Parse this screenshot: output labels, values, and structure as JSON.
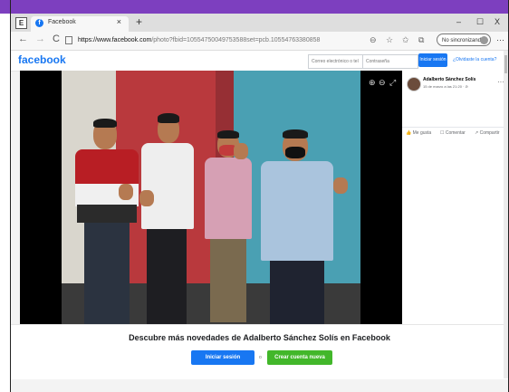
{
  "browser": {
    "logo": "E",
    "tab": {
      "title": "Facebook",
      "close": "×"
    },
    "new_tab": "+",
    "window_controls": [
      "–",
      "☐",
      "X"
    ],
    "nav": {
      "back": "←",
      "forward": "→",
      "reload": "C"
    },
    "url": {
      "host": "https://www.facebook.com",
      "rest": "/photo?fbid=10554750049753588set=pcb.10554763380858"
    },
    "toolbar_icons": [
      "zoom-icon",
      "favorites-icon",
      "collections-icon",
      "extensions-icon"
    ],
    "sync_label": "No sincronizando",
    "menu": "···"
  },
  "facebook": {
    "logo": "facebook",
    "email_placeholder": "Correo electrónico o tel",
    "password_placeholder": "Contraseña",
    "login_button": "Iniciar sesión",
    "forgot_link": "¿Olvidaste la cuenta?"
  },
  "viewer": {
    "zoom_in": "⊕",
    "zoom_out": "⊖",
    "fullscreen": "⤢"
  },
  "post": {
    "author": "Adalberto Sánchez Solís",
    "date": "15 de marzo a las 21:20 · ⊘",
    "more": "···",
    "actions": [
      {
        "icon": "👍",
        "label": "Me gusta"
      },
      {
        "icon": "☐",
        "label": "Comentar"
      },
      {
        "icon": "↗",
        "label": "Compartir"
      }
    ]
  },
  "bottom": {
    "prompt": "Descubre más novedades de Adalberto Sánchez Solís en Facebook",
    "login_button": "Iniciar sesión",
    "or": "o",
    "create_button": "Crear cuenta nueva"
  },
  "colors": {
    "accent_purple": "#7d3fbf",
    "facebook_blue": "#1877f2",
    "create_green": "#42b72a"
  }
}
